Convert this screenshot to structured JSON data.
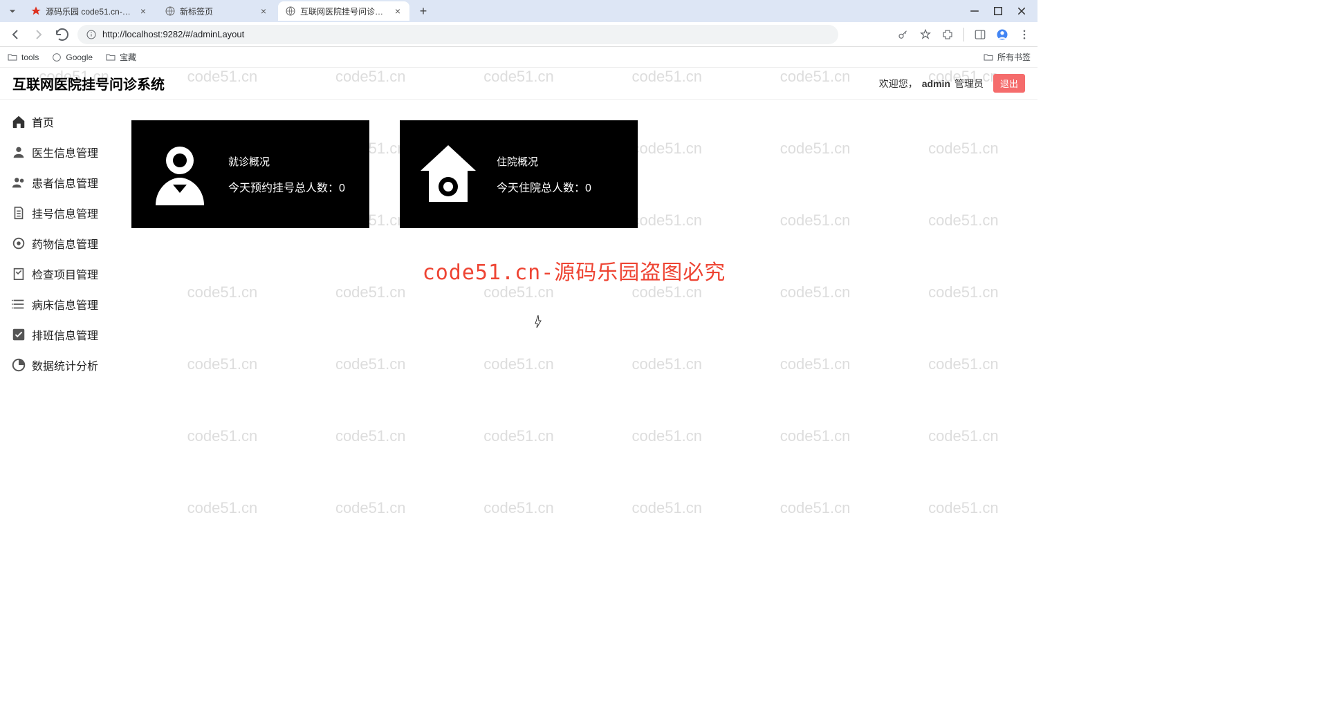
{
  "browser": {
    "tabs": [
      {
        "title": "源码乐园 code51.cn-项目论文…"
      },
      {
        "title": "新标签页"
      },
      {
        "title": "互联网医院挂号问诊系统"
      }
    ],
    "url": "http://localhost:9282/#/adminLayout",
    "bookmarks": [
      {
        "label": "tools"
      },
      {
        "label": "Google"
      },
      {
        "label": "宝藏"
      }
    ],
    "all_bookmarks": "所有书签"
  },
  "app": {
    "title": "互联网医院挂号问诊系统",
    "welcome": "欢迎您，",
    "username": "admin",
    "role": "管理员",
    "logout": "退出"
  },
  "sidebar": {
    "items": [
      {
        "label": "首页"
      },
      {
        "label": "医生信息管理"
      },
      {
        "label": "患者信息管理"
      },
      {
        "label": "挂号信息管理"
      },
      {
        "label": "药物信息管理"
      },
      {
        "label": "检查项目管理"
      },
      {
        "label": "病床信息管理"
      },
      {
        "label": "排班信息管理"
      },
      {
        "label": "数据统计分析"
      }
    ]
  },
  "dashboard": {
    "card1": {
      "title": "就诊概况",
      "label": "今天预约挂号总人数：",
      "value": "0"
    },
    "card2": {
      "title": "住院概况",
      "label": "今天住院总人数：",
      "value": "0"
    }
  },
  "watermark": {
    "repeat": "code51.cn",
    "notice": "code51.cn-源码乐园盗图必究"
  }
}
